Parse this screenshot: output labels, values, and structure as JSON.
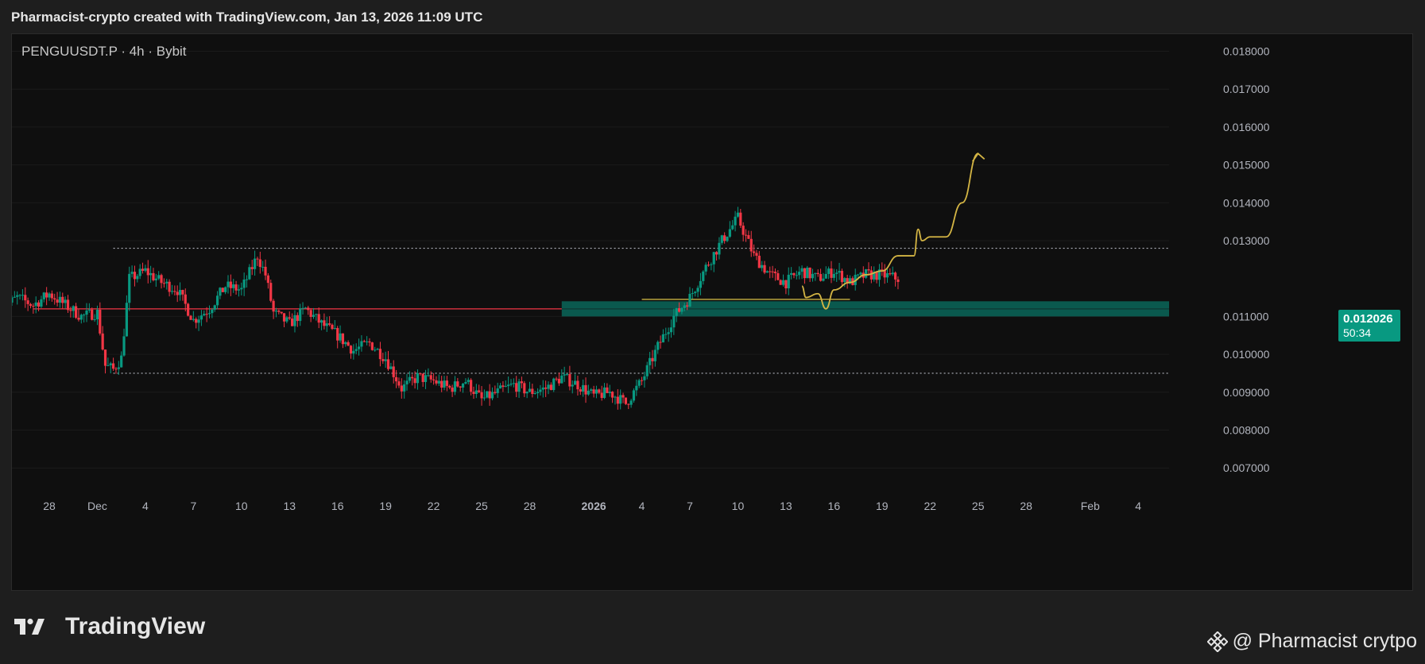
{
  "header": {
    "title": "Pharmacist-crypto created with TradingView.com, Jan 13, 2026 11:09 UTC"
  },
  "chart": {
    "symbol_line": "PENGUUSDT.P · 4h · Bybit",
    "last_price": "0.012026",
    "countdown": "50:34"
  },
  "footer": {
    "logo_text": "TradingView",
    "watermark": "@ Pharmacist crytpo"
  },
  "chart_data": {
    "type": "candlestick",
    "title": "PENGUUSDT.P · 4h · Bybit",
    "y_axis": {
      "range": [
        0.0064,
        0.0185
      ],
      "tick_labels": [
        "0.018000",
        "0.017000",
        "0.016000",
        "0.015000",
        "0.014000",
        "0.013000",
        "0.011000",
        "0.010000",
        "0.009000",
        "0.008000",
        "0.007000"
      ]
    },
    "x_axis": {
      "ticks": [
        {
          "label": "28",
          "date": "2025-11-28"
        },
        {
          "label": "Dec",
          "date": "2025-12-01"
        },
        {
          "label": "4",
          "date": "2025-12-04"
        },
        {
          "label": "7",
          "date": "2025-12-07"
        },
        {
          "label": "10",
          "date": "2025-12-10"
        },
        {
          "label": "13",
          "date": "2025-12-13"
        },
        {
          "label": "16",
          "date": "2025-12-16"
        },
        {
          "label": "19",
          "date": "2025-12-19"
        },
        {
          "label": "22",
          "date": "2025-12-22"
        },
        {
          "label": "25",
          "date": "2025-12-25"
        },
        {
          "label": "28",
          "date": "2025-12-28"
        },
        {
          "label": "2026",
          "date": "2026-01-01",
          "bold": true
        },
        {
          "label": "4",
          "date": "2026-01-04"
        },
        {
          "label": "7",
          "date": "2026-01-07"
        },
        {
          "label": "10",
          "date": "2026-01-10"
        },
        {
          "label": "13",
          "date": "2026-01-13"
        },
        {
          "label": "16",
          "date": "2026-01-16"
        },
        {
          "label": "19",
          "date": "2026-01-19"
        },
        {
          "label": "22",
          "date": "2026-01-22"
        },
        {
          "label": "25",
          "date": "2026-01-25"
        },
        {
          "label": "28",
          "date": "2026-01-28"
        },
        {
          "label": "Feb",
          "date": "2026-02-01"
        },
        {
          "label": "4",
          "date": "2026-02-04"
        }
      ]
    },
    "price_path": [
      [
        "2025-11-25",
        0.0112
      ],
      [
        "2025-11-26",
        0.0115
      ],
      [
        "2025-11-27",
        0.0113
      ],
      [
        "2025-11-28",
        0.0116
      ],
      [
        "2025-11-29",
        0.0113
      ],
      [
        "2025-11-30",
        0.011
      ],
      [
        "2025-12-01",
        0.0111
      ],
      [
        "2025-12-01 12:00",
        0.0097
      ],
      [
        "2025-12-02",
        0.0096
      ],
      [
        "2025-12-02 12:00",
        0.0099
      ],
      [
        "2025-12-03",
        0.012
      ],
      [
        "2025-12-04",
        0.0122
      ],
      [
        "2025-12-05",
        0.0119
      ],
      [
        "2025-12-06",
        0.0117
      ],
      [
        "2025-12-07",
        0.0109
      ],
      [
        "2025-12-08",
        0.0112
      ],
      [
        "2025-12-09",
        0.0118
      ],
      [
        "2025-12-10",
        0.0117
      ],
      [
        "2025-12-11",
        0.0126
      ],
      [
        "2025-12-11 12:00",
        0.0121
      ],
      [
        "2025-12-12",
        0.0111
      ],
      [
        "2025-12-13",
        0.0108
      ],
      [
        "2025-12-14",
        0.0112
      ],
      [
        "2025-12-15",
        0.0108
      ],
      [
        "2025-12-16",
        0.0105
      ],
      [
        "2025-12-17",
        0.0101
      ],
      [
        "2025-12-18",
        0.0103
      ],
      [
        "2025-12-19",
        0.0099
      ],
      [
        "2025-12-20",
        0.0091
      ],
      [
        "2025-12-21",
        0.0094
      ],
      [
        "2025-12-22",
        0.0093
      ],
      [
        "2025-12-23",
        0.0091
      ],
      [
        "2025-12-24",
        0.0093
      ],
      [
        "2025-12-25",
        0.0088
      ],
      [
        "2025-12-26",
        0.009
      ],
      [
        "2025-12-27",
        0.0092
      ],
      [
        "2025-12-28",
        0.009
      ],
      [
        "2025-12-29",
        0.0091
      ],
      [
        "2025-12-30",
        0.0094
      ],
      [
        "2025-12-31",
        0.0092
      ],
      [
        "2026-01-01",
        0.0089
      ],
      [
        "2026-01-02",
        0.009
      ],
      [
        "2026-01-03",
        0.0087
      ],
      [
        "2026-01-04",
        0.0093
      ],
      [
        "2026-01-05",
        0.0102
      ],
      [
        "2026-01-06",
        0.011
      ],
      [
        "2026-01-07",
        0.0115
      ],
      [
        "2026-01-08",
        0.0123
      ],
      [
        "2026-01-09",
        0.013
      ],
      [
        "2026-01-10",
        0.0136
      ],
      [
        "2026-01-11",
        0.0126
      ],
      [
        "2026-01-12",
        0.0121
      ],
      [
        "2026-01-13",
        0.0119
      ],
      [
        "2026-01-14",
        0.0122
      ],
      [
        "2026-01-15",
        0.012
      ],
      [
        "2026-01-16",
        0.0122
      ],
      [
        "2026-01-17",
        0.0119
      ],
      [
        "2026-01-18",
        0.0121
      ],
      [
        "2026-01-19",
        0.0121
      ],
      [
        "2026-01-20",
        0.012
      ]
    ],
    "horizontal_lines": [
      {
        "price": 0.0128,
        "from": "2025-12-02",
        "style": "dotted",
        "color": "#b2b5be"
      },
      {
        "price": 0.0095,
        "from": "2025-12-02",
        "style": "dotted",
        "color": "#b2b5be"
      },
      {
        "price": 0.0112,
        "from": "2025-11-27",
        "to": "2025-12-30",
        "style": "solid",
        "color": "#f23645"
      },
      {
        "price": 0.01145,
        "from": "2026-01-04",
        "to": "2026-01-17",
        "style": "solid",
        "color": "#f0d44c"
      }
    ],
    "zones": [
      {
        "from_price": 0.011,
        "to_price": 0.0114,
        "from": "2025-12-30",
        "color": "#0b5e52"
      }
    ],
    "projection_color": "#d4b544",
    "projection": [
      [
        "2026-01-14",
        0.0118
      ],
      [
        "2026-01-14 06:00",
        0.0115
      ],
      [
        "2026-01-15",
        0.0116
      ],
      [
        "2026-01-15 12:00",
        0.0112
      ],
      [
        "2026-01-16",
        0.0117
      ],
      [
        "2026-01-17",
        0.0119
      ],
      [
        "2026-01-18",
        0.0121
      ],
      [
        "2026-01-19",
        0.0122
      ],
      [
        "2026-01-20",
        0.0126
      ],
      [
        "2026-01-21",
        0.0126
      ],
      [
        "2026-01-21 06:00",
        0.0133
      ],
      [
        "2026-01-21 12:00",
        0.013
      ],
      [
        "2026-01-22",
        0.0131
      ],
      [
        "2026-01-23",
        0.0131
      ],
      [
        "2026-01-24",
        0.014
      ],
      [
        "2026-01-25",
        0.0153
      ]
    ],
    "colors": {
      "up": "#089981",
      "down": "#f23645",
      "grid": "#1b1b1b",
      "background": "#0f0f0f"
    }
  }
}
